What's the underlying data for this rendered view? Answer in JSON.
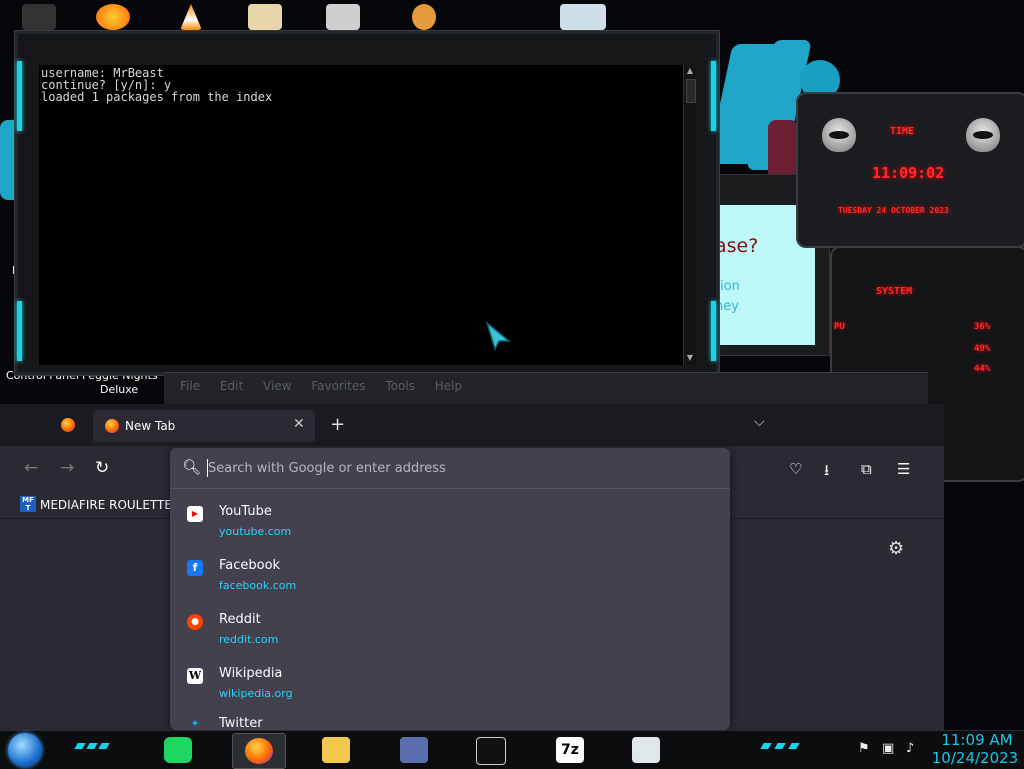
{
  "desktop": {
    "labels": {
      "control_panel": "Control Panel",
      "peggle_line1": "Peggle Nights",
      "peggle_line2": "Deluxe",
      "re": "Re"
    }
  },
  "terminal": {
    "lines": [
      "username: MrBeast",
      "continue? [y/n]: y",
      "loaded 1 packages from the index"
    ]
  },
  "background_window": {
    "big_text": "ase?",
    "line1": "tion",
    "line2": "ney"
  },
  "gadget_time": {
    "title": "TIME",
    "time": "11:09:02",
    "date": "TUESDAY 24 OCTOBER 2023"
  },
  "gadget_system": {
    "title": "SYSTEM",
    "cpu_label": "PU",
    "values": [
      "36%",
      "49%",
      "44%"
    ]
  },
  "menubar": {
    "items": [
      "File",
      "Edit",
      "View",
      "Favorites",
      "Tools",
      "Help"
    ]
  },
  "firefox": {
    "tab_title": "New Tab",
    "tab_close": "✕",
    "new_tab": "+",
    "list_tabs": "⌵",
    "bookmark_label": "MEDIAFIRE ROULETTER",
    "bookmark_icon_text": "MF T",
    "urlbar_placeholder": "Search with Google or enter address",
    "suggestions": [
      {
        "title": "YouTube",
        "url": "youtube.com",
        "icon": "▶",
        "color": "#ff0000"
      },
      {
        "title": "Facebook",
        "url": "facebook.com",
        "icon": "f",
        "color": "#1877f2"
      },
      {
        "title": "Reddit",
        "url": "reddit.com",
        "icon": "●",
        "color": "#ff4500"
      },
      {
        "title": "Wikipedia",
        "url": "wikipedia.org",
        "icon": "W",
        "color": "#ffffff"
      },
      {
        "title": "Twitter",
        "url": "",
        "icon": "✦",
        "color": "#1da1f2"
      }
    ]
  },
  "taskbar": {
    "time": "11:09 AM",
    "date": "10/24/2023"
  }
}
